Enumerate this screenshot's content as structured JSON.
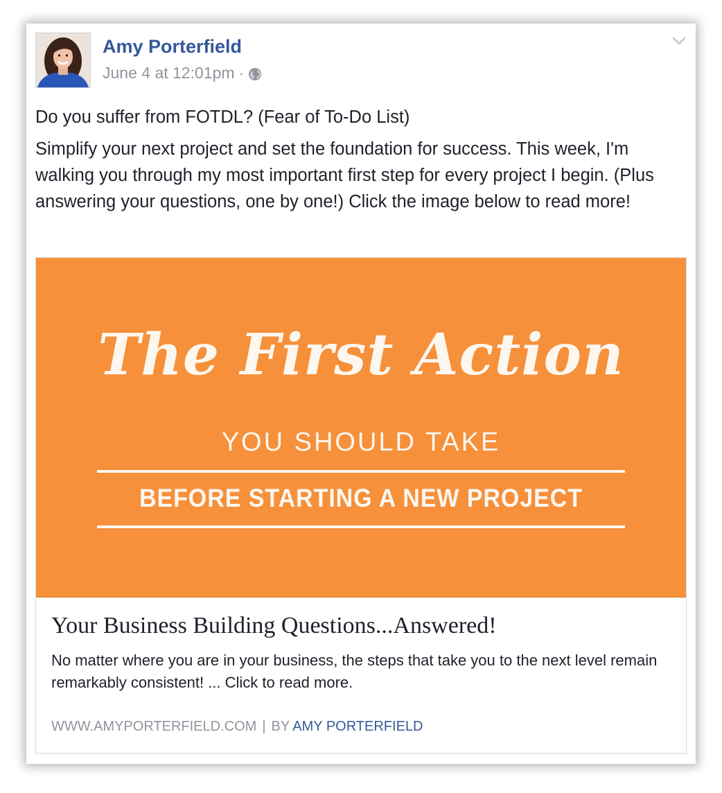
{
  "post": {
    "author_name": "Amy Porterfield",
    "timestamp": "June 4 at 12:01pm",
    "separator": "·",
    "privacy_icon": "globe-icon",
    "menu_icon": "chevron-down-icon",
    "text_line1": "Do you suffer from FOTDL? (Fear of To-Do List)",
    "text_line2": "Simplify your next project and set the foundation for success. This week, I'm walking you through my most important first step for every project I begin. (Plus answering your questions, one by one!) Click the image below to read more!"
  },
  "link_preview": {
    "banner": {
      "script_title": "The First Action",
      "subtitle": "YOU SHOULD TAKE",
      "tagline": "BEFORE STARTING A NEW PROJECT",
      "background_color": "#f6903a"
    },
    "title": "Your Business Building Questions...Answered!",
    "description": "No matter where you are in your business, the steps that take you to the next level remain remarkably consistent! ... Click to read more.",
    "domain": "WWW.AMYPORTERFIELD.COM",
    "divider": "|",
    "byline_prefix": "BY",
    "byline_author": "AMY PORTERFIELD"
  },
  "colors": {
    "author_link": "#365899",
    "meta_text": "#90949c",
    "body_text": "#1d2129"
  }
}
